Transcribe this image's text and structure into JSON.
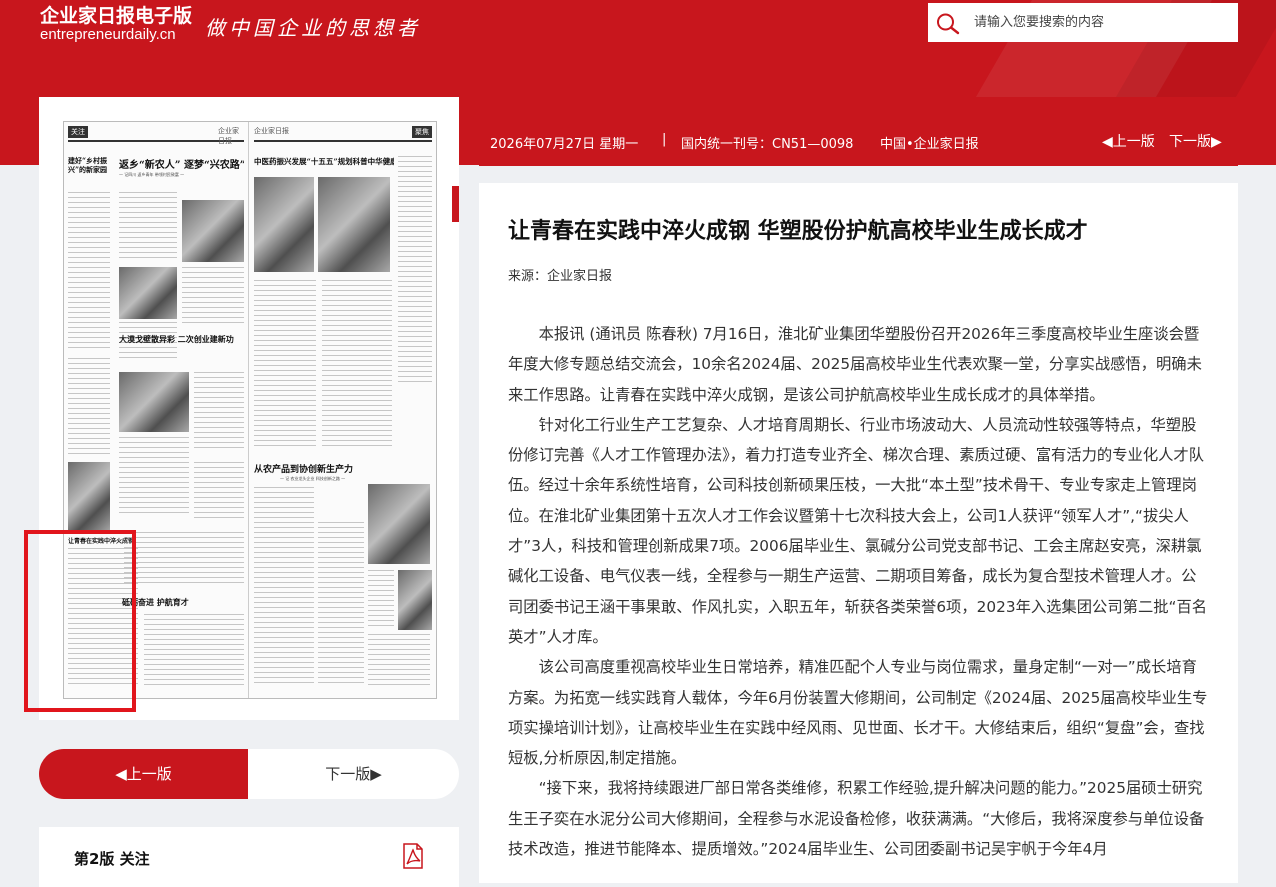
{
  "header": {
    "logo_cn": "企业家日报电子版",
    "logo_en": "entrepreneurdaily.cn",
    "slogan": "做中国企业的思想者",
    "search_placeholder": "请输入您要搜索的内容"
  },
  "infobar": {
    "date": "2026年07月27日 星期一",
    "separator": "|",
    "issn": "国内统一刊号：CN51—0098",
    "publication": "中国•企业家日报",
    "prev_label": "上一版",
    "next_label": "下一版"
  },
  "pager": {
    "prev_label": "上一版",
    "next_label": "下一版"
  },
  "follow": {
    "label": "第2版 关注",
    "icon": "pdf-icon"
  },
  "article": {
    "title": "让青春在实践中淬火成钢 华塑股份护航高校毕业生成长成才",
    "source": "来源：企业家日报",
    "paragraphs": [
      "本报讯 (通讯员 陈春秋) 7月16日，淮北矿业集团华塑股份召开2026年三季度高校毕业生座谈会暨年度大修专题总结交流会，10余名2024届、2025届高校毕业生代表欢聚一堂，分享实战感悟，明确未来工作思路。让青春在实践中淬火成钢，是该公司护航高校毕业生成长成才的具体举措。",
      "针对化工行业生产工艺复杂、人才培育周期长、行业市场波动大、人员流动性较强等特点，华塑股份修订完善《人才工作管理办法》，着力打造专业齐全、梯次合理、素质过硬、富有活力的专业化人才队伍。经过十余年系统性培育，公司科技创新硕果压枝，一大批“本土型”技术骨干、专业专家走上管理岗位。在淮北矿业集团第十五次人才工作会议暨第十七次科技大会上，公司1人获评“领军人才”,“拔尖人才”3人，科技和管理创新成果7项。2006届毕业生、氯碱分公司党支部书记、工会主席赵安亮，深耕氯碱化工设备、电气仪表一线，全程参与一期生产运营、二期项目筹备，成长为复合型技术管理人才。公司团委书记王涵干事果敢、作风扎实，入职五年，斩获各类荣誉6项，2023年入选集团公司第二批“百名英才”人才库。",
      "该公司高度重视高校毕业生日常培养，精准匹配个人专业与岗位需求，量身定制“一对一”成长培育方案。为拓宽一线实践育人载体，今年6月份装置大修期间，公司制定《2024届、2025届高校毕业生专项实操培训计划》，让高校毕业生在实践中经风雨、见世面、长才干。大修结束后，组织“复盘”会，查找短板,分析原因,制定措施。",
      "“接下来，我将持续跟进厂部日常各类维修，积累工作经验,提升解决问题的能力。”2025届硕士研究生王子奕在水泥分公司大修期间，全程参与水泥设备检修，收获满满。“大修后，我将深度参与单位设备技术改造，推进节能降本、提质增效。”2024届毕业生、公司团委副书记吴宇帆于今年4月"
    ]
  },
  "newspaper": {
    "left_page_tag": "关注",
    "left_page_header": "企业家日报",
    "right_page_header": "企业家日报",
    "right_page_tag": "聚焦",
    "headlines": [
      "返乡“新农人”  逐梦“兴农路”",
      "中医药振兴发展“十五五”规划科普中华健康新篇章",
      "大漠戈壁散异彩  二次创业建新功",
      "从农产品到协创新生产力",
      "让青春在实践中淬火成钢",
      "建好“乡村振兴”的新家园",
      "砥砺奋进 护航育才"
    ]
  }
}
